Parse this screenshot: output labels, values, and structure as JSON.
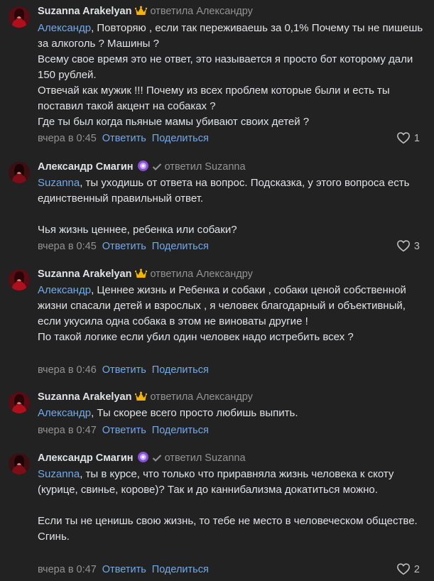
{
  "comments": [
    {
      "author": "Suzanna Arakelyan",
      "badge": "crown-emoji-icon",
      "reply_to": "ответила Александру",
      "mention": "Александр",
      "text": [
        ", Повторяю , если так переживаешь за 0,1% Почему ты не пишешь за алкоголь ? Машины ?",
        "Всему свое время это не ответ, это называется я просто бот которому дали 150 рублей.",
        "Отвечай как мужик !!! Почему из всех проблем которые были и есть ты поставил такой акцент на собаках ?",
        "Где ты был когда пьяные мамы убивают своих детей ?"
      ],
      "time": "вчера в 0:45",
      "reply_label": "Ответить",
      "share_label": "Поделиться",
      "likes": "1"
    },
    {
      "author": "Александр Смагин",
      "badge": "purple-gem-emoji-icon",
      "reply_to": "ответил Suzanna",
      "mention": "Suzanna",
      "text": [
        ", ты уходишь от ответа на вопрос. Подсказка, у этого вопроса есть единственный правильный ответ.",
        "",
        "Чья жизнь ценнее, ребенка или собаки?"
      ],
      "time": "вчера в 0:45",
      "reply_label": "Ответить",
      "share_label": "Поделиться",
      "likes": "3"
    },
    {
      "author": "Suzanna Arakelyan",
      "badge": "crown-emoji-icon",
      "reply_to": "ответила Александру",
      "mention": "Александр",
      "text": [
        ", Ценнее жизнь и Ребенка и собаки , собаки ценой собственной жизни спасали детей и взрослых , я человек благодарный и объективный, если укусила одна собака в этом не виноваты другие !",
        "По такой логике если убил один человек надо истребить всех ?"
      ],
      "time": "вчера в 0:46",
      "reply_label": "Ответить",
      "share_label": "Поделиться",
      "likes": ""
    },
    {
      "author": "Suzanna Arakelyan",
      "badge": "crown-emoji-icon",
      "reply_to": "ответила Александру",
      "mention": "Александр",
      "text": [
        ", Ты скорее всего просто любишь выпить."
      ],
      "time": "вчера в 0:47",
      "reply_label": "Ответить",
      "share_label": "Поделиться",
      "likes": ""
    },
    {
      "author": "Александр Смагин",
      "badge": "purple-gem-emoji-icon",
      "reply_to": "ответил Suzanna",
      "mention": "Suzanna",
      "text": [
        ", ты в курсе, что только что приравняла жизнь человека к скоту (курице, свинье, корове)? Так и до каннибализма докатиться можно.",
        "",
        "Если ты не ценишь свою жизнь, то тебе не место в человеческом обществе. Сгинь."
      ],
      "time": "вчера в 0:47",
      "reply_label": "Ответить",
      "share_label": "Поделиться",
      "likes": "2"
    }
  ],
  "colors": {
    "background": "#222222",
    "text": "#e1e3e6",
    "link": "#71aaeb",
    "muted": "#939393"
  }
}
